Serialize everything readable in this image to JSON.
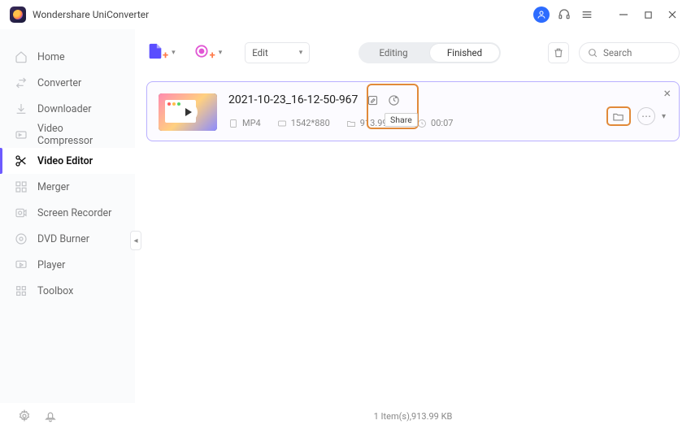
{
  "app": {
    "title": "Wondershare UniConverter"
  },
  "search": {
    "placeholder": "Search"
  },
  "toolbar": {
    "edit_dropdown": "Edit"
  },
  "tabs": {
    "editing": "Editing",
    "finished": "Finished"
  },
  "sidebar": {
    "items": [
      {
        "label": "Home"
      },
      {
        "label": "Converter"
      },
      {
        "label": "Downloader"
      },
      {
        "label": "Video Compressor"
      },
      {
        "label": "Video Editor"
      },
      {
        "label": "Merger"
      },
      {
        "label": "Screen Recorder"
      },
      {
        "label": "DVD Burner"
      },
      {
        "label": "Player"
      },
      {
        "label": "Toolbox"
      }
    ]
  },
  "file": {
    "title": "2021-10-23_16-12-50-967",
    "format": "MP4",
    "resolution": "1542*880",
    "size": "913.99 KB",
    "duration": "00:07",
    "share_tooltip": "Share"
  },
  "footer": {
    "status": "1 Item(s),913.99 KB"
  }
}
